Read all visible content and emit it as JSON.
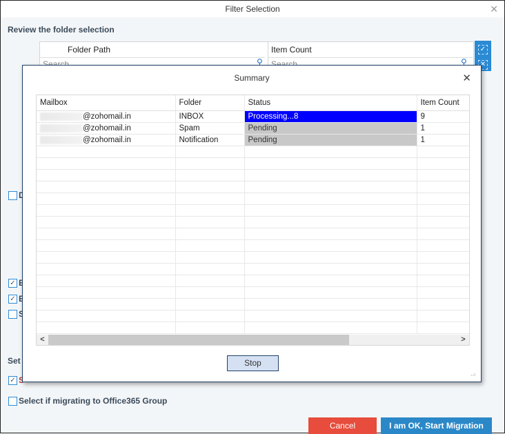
{
  "window": {
    "title": "Filter Selection",
    "close_icon": "close-icon"
  },
  "review": {
    "heading": "Review the folder selection",
    "grid": {
      "columns": [
        "Folder Path",
        "Item Count"
      ],
      "search_placeholders": [
        "Search",
        "Search"
      ]
    },
    "side_buttons": [
      "select-all-icon",
      "deselect-all-icon"
    ]
  },
  "options": {
    "partial_labels": [
      "D",
      "E",
      "E",
      "S"
    ],
    "checked": [
      false,
      true,
      true,
      false
    ],
    "set_heading_partial": "Set c",
    "red_option_partial": "S",
    "red_option_checked": true,
    "office365_label": "Select if migrating to Office365 Group",
    "office365_checked": false
  },
  "summary": {
    "title": "Summary",
    "columns": [
      "Mailbox",
      "Folder",
      "Status",
      "Item Count"
    ],
    "rows": [
      {
        "mailbox_suffix": "@zohomail.in",
        "folder": "INBOX",
        "status": "Processing...8",
        "status_type": "processing",
        "item_count": "9"
      },
      {
        "mailbox_suffix": "@zohomail.in",
        "folder": "Spam",
        "status": "Pending",
        "status_type": "pending",
        "item_count": "1"
      },
      {
        "mailbox_suffix": "@zohomail.in",
        "folder": "Notification",
        "status": "Pending",
        "status_type": "pending",
        "item_count": "1"
      }
    ],
    "stop_label": "Stop",
    "colors": {
      "processing": "#0000ff",
      "pending": "#c8c8c8"
    }
  },
  "footer": {
    "cancel_label": "Cancel",
    "start_label": "I am OK, Start Migration",
    "cancel_color": "#e74c3c",
    "start_color": "#2b88c8"
  }
}
